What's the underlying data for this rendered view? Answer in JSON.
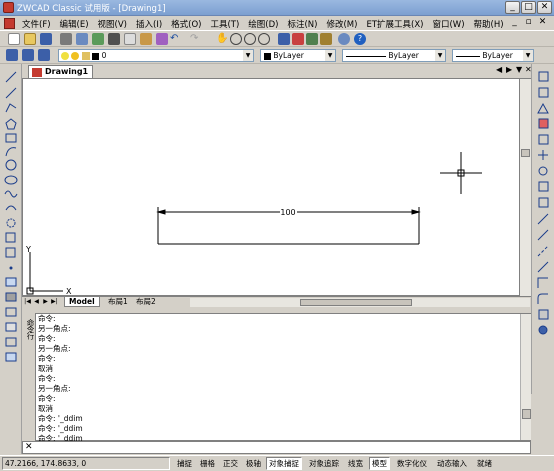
{
  "window": {
    "title": "ZWCAD Classic 试用版 - [Drawing1]"
  },
  "menu": [
    "文件(F)",
    "编辑(E)",
    "视图(V)",
    "插入(I)",
    "格式(O)",
    "工具(T)",
    "绘图(D)",
    "标注(N)",
    "修改(M)",
    "ET扩展工具(X)",
    "窗口(W)",
    "帮助(H)"
  ],
  "toolbar2": {
    "layer": "0",
    "color": "ByLayer",
    "linetype": "ByLayer",
    "lineweight": "ByLayer"
  },
  "document_tab": {
    "label": "Drawing1"
  },
  "canvas": {
    "dimension_text": "100",
    "ucs_y_label": "Y",
    "ucs_x_label": "X"
  },
  "layout_tabs": [
    "Model",
    "布局1",
    "布局2"
  ],
  "command_side_label": "命令行",
  "command_history": [
    "命令:",
    "另一角点:",
    "命令:",
    "另一角点:",
    "命令:",
    "取消",
    "命令:",
    "另一角点:",
    "命令:",
    "取消",
    "命令: '_ddim",
    "命令: '_ddim",
    "命令: '_ddim"
  ],
  "status": {
    "coords": "47.2166,  174.8633,  0",
    "buttons": [
      {
        "label": "捕捉",
        "on": false
      },
      {
        "label": "栅格",
        "on": false
      },
      {
        "label": "正交",
        "on": false
      },
      {
        "label": "极轴",
        "on": false
      },
      {
        "label": "对象捕捉",
        "on": true
      },
      {
        "label": "对象追踪",
        "on": false
      },
      {
        "label": "线宽",
        "on": false
      },
      {
        "label": "模型",
        "on": true
      },
      {
        "label": "数字化仪",
        "on": false
      },
      {
        "label": "动态输入",
        "on": false
      },
      {
        "label": "就绪",
        "on": false
      }
    ]
  },
  "colors": {
    "title_bar": "#7c9fd0",
    "canvas": "#ffffff",
    "chrome": "#d4d0c8"
  }
}
